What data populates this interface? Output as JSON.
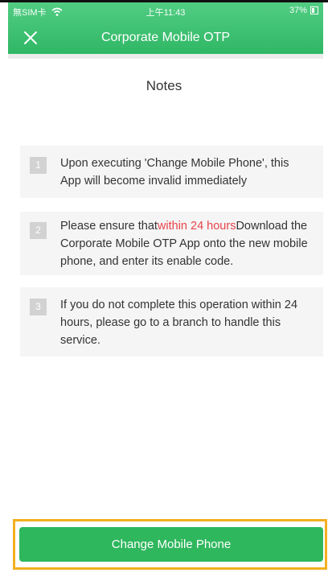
{
  "status_bar": {
    "carrier": "無SIM卡",
    "time": "上午11:43",
    "battery": "37%"
  },
  "header": {
    "title": "Corporate Mobile OTP",
    "close_icon": "close-icon"
  },
  "page": {
    "title": "Notes"
  },
  "notes": [
    {
      "number": "1",
      "text": "Upon executing 'Change Mobile Phone', this App will become invalid immediately"
    },
    {
      "number": "2",
      "text_before": "Please ensure that",
      "text_highlight": "within 24 hours",
      "text_after": "Download the Corporate Mobile OTP App onto the new mobile phone, and enter its enable code."
    },
    {
      "number": "3",
      "text": "If you do not complete this operation within 24 hours, please go to a branch to handle this service."
    }
  ],
  "action": {
    "button_label": "Change Mobile Phone"
  },
  "colors": {
    "header_green": "#2fb765",
    "button_green": "#2fb75e",
    "highlight_red": "#e8444a",
    "frame_yellow": "#f2b01f"
  }
}
